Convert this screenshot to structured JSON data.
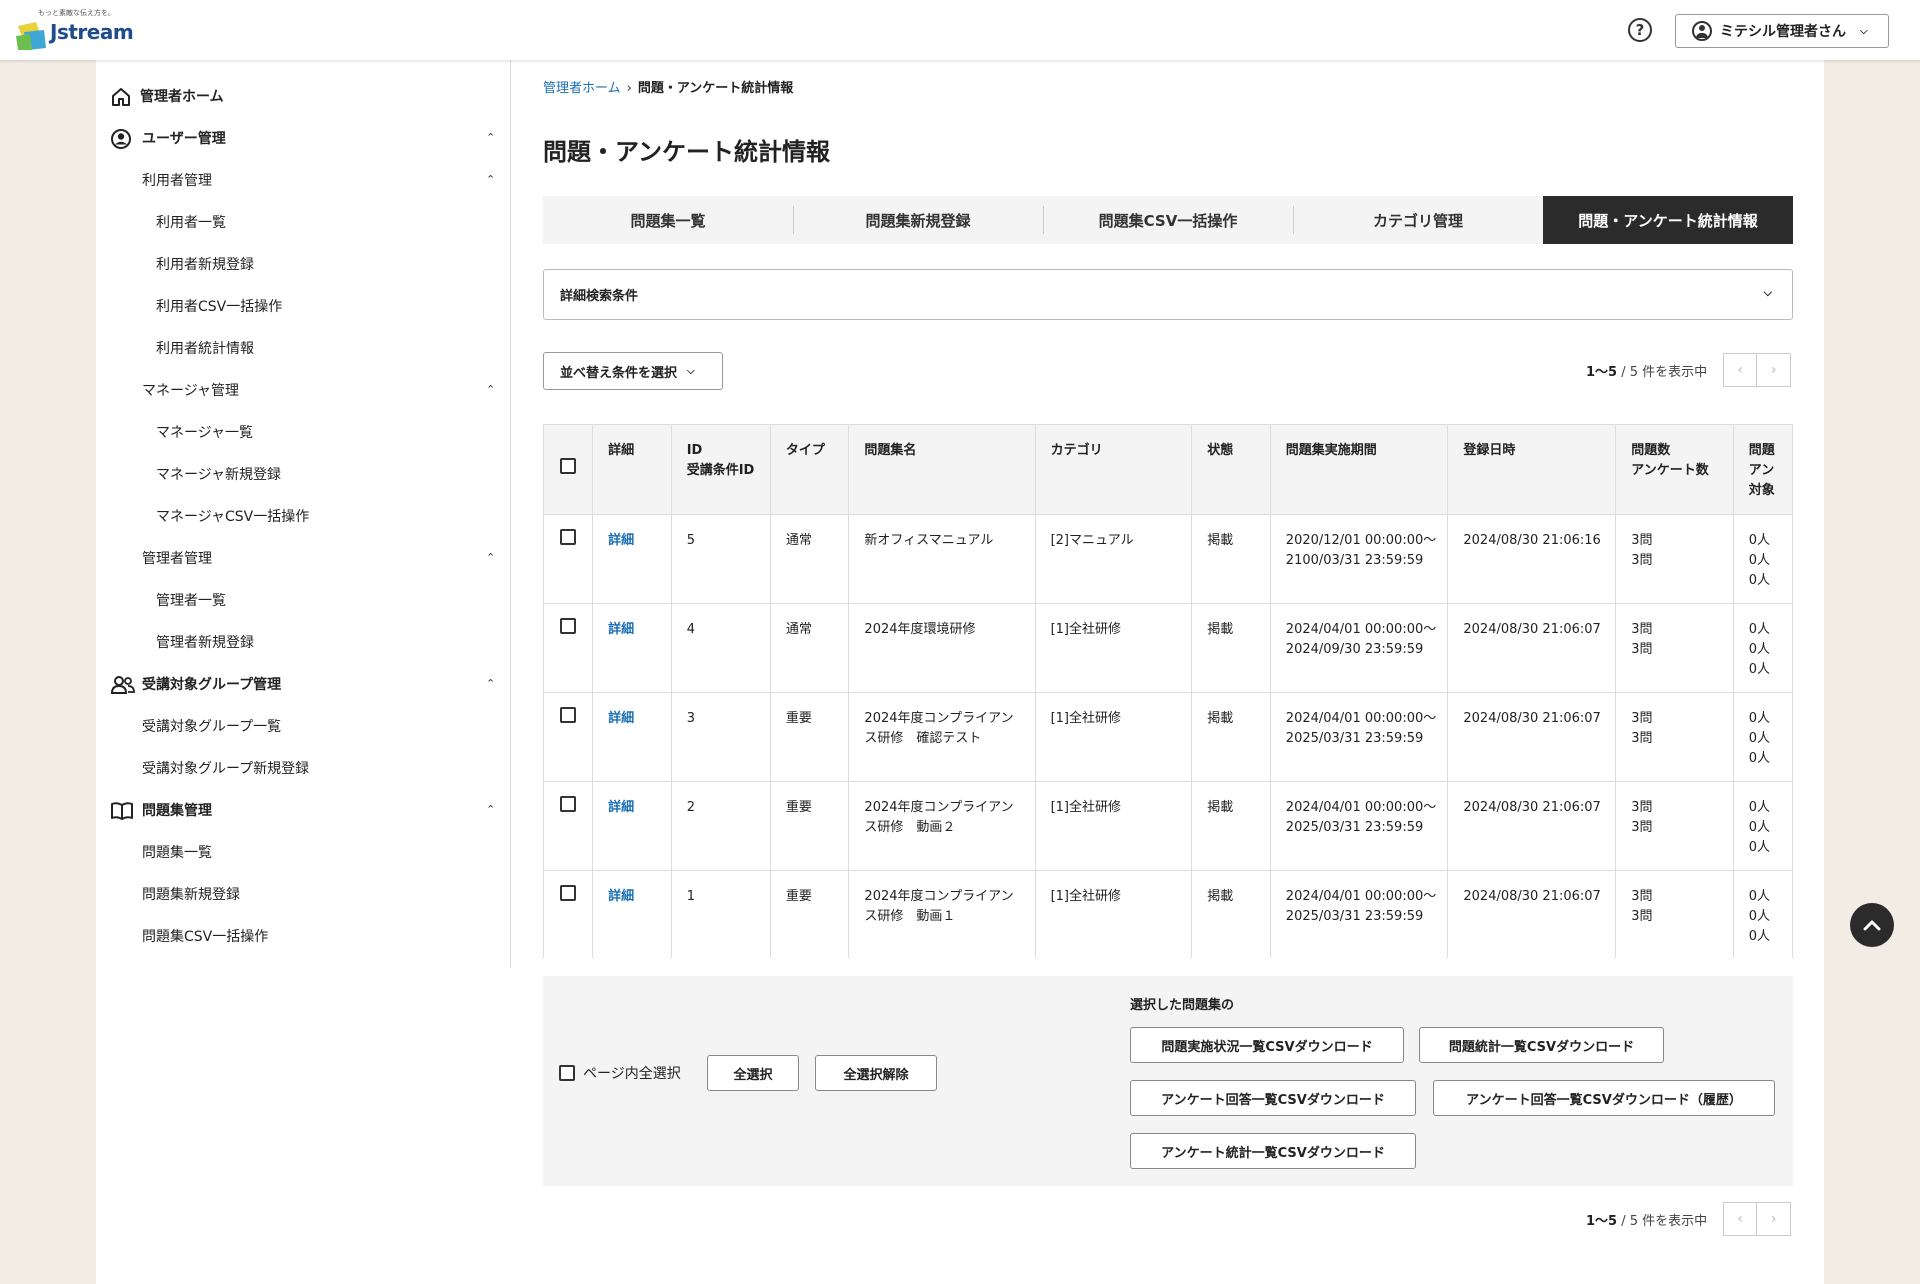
{
  "header": {
    "logo_tagline": "もっと素敵な伝え方を。",
    "logo_word": "Jstream",
    "help_symbol": "?",
    "user_label": "ミテシル管理者さん"
  },
  "sidebar": {
    "home": "管理者ホーム",
    "user_mgmt": "ユーザー管理",
    "user_admin": "利用者管理",
    "user_list": "利用者一覧",
    "user_new": "利用者新規登録",
    "user_csv": "利用者CSV一括操作",
    "user_stats": "利用者統計情報",
    "manager_mgmt": "マネージャ管理",
    "manager_list": "マネージャ一覧",
    "manager_new": "マネージャ新規登録",
    "manager_csv": "マネージャCSV一括操作",
    "admin_mgmt": "管理者管理",
    "admin_list": "管理者一覧",
    "admin_new": "管理者新規登録",
    "group_mgmt": "受講対象グループ管理",
    "group_list": "受講対象グループ一覧",
    "group_new": "受講対象グループ新規登録",
    "quiz_mgmt": "問題集管理",
    "quiz_list": "問題集一覧",
    "quiz_new": "問題集新規登録",
    "quiz_csv": "問題集CSV一括操作"
  },
  "breadcrumb": {
    "home": "管理者ホーム",
    "current": "問題・アンケート統計情報"
  },
  "page_title": "問題・アンケート統計情報",
  "tabs": [
    {
      "label": "問題集一覧"
    },
    {
      "label": "問題集新規登録"
    },
    {
      "label": "問題集CSV一括操作"
    },
    {
      "label": "カテゴリ管理"
    },
    {
      "label": "問題・アンケート統計情報"
    }
  ],
  "search_panel_label": "詳細検索条件",
  "sort_button_label": "並べ替え条件を選択",
  "pager": {
    "range": "1〜5",
    "total": " / 5 件を表示中"
  },
  "table": {
    "headers": {
      "detail": "詳細",
      "id": "ID\n受講条件ID",
      "type": "タイプ",
      "name": "問題集名",
      "category": "カテゴリ",
      "status": "状態",
      "period": "問題集実施期間",
      "registered": "登録日時",
      "counts": "問題数\nアンケート数",
      "targets": "問題\nアン\n対象"
    },
    "rows": [
      {
        "detail": "詳細",
        "id": "5",
        "type": "通常",
        "name": "新オフィスマニュアル",
        "category": "[2]マニュアル",
        "status": "掲載",
        "period": "2020/12/01 00:00:00〜\n2100/03/31 23:59:59",
        "registered": "2024/08/30 21:06:16",
        "counts": "3問\n3問",
        "targets": "0人\n0人\n0人"
      },
      {
        "detail": "詳細",
        "id": "4",
        "type": "通常",
        "name": "2024年度環境研修",
        "category": "[1]全社研修",
        "status": "掲載",
        "period": "2024/04/01 00:00:00〜\n2024/09/30 23:59:59",
        "registered": "2024/08/30 21:06:07",
        "counts": "3問\n3問",
        "targets": "0人\n0人\n0人"
      },
      {
        "detail": "詳細",
        "id": "3",
        "type": "重要",
        "name": "2024年度コンプライアン\nス研修　確認テスト",
        "category": "[1]全社研修",
        "status": "掲載",
        "period": "2024/04/01 00:00:00〜\n2025/03/31 23:59:59",
        "registered": "2024/08/30 21:06:07",
        "counts": "3問\n3問",
        "targets": "0人\n0人\n0人"
      },
      {
        "detail": "詳細",
        "id": "2",
        "type": "重要",
        "name": "2024年度コンプライアン\nス研修　動画２",
        "category": "[1]全社研修",
        "status": "掲載",
        "period": "2024/04/01 00:00:00〜\n2025/03/31 23:59:59",
        "registered": "2024/08/30 21:06:07",
        "counts": "3問\n3問",
        "targets": "0人\n0人\n0人"
      },
      {
        "detail": "詳細",
        "id": "1",
        "type": "重要",
        "name": "2024年度コンプライアン\nス研修　動画１",
        "category": "[1]全社研修",
        "status": "掲載",
        "period": "2024/04/01 00:00:00〜\n2025/03/31 23:59:59",
        "registered": "2024/08/30 21:06:07",
        "counts": "3問\n3問",
        "targets": "0人\n0人\n0人"
      }
    ]
  },
  "actions": {
    "page_select_label": "ページ内全選択",
    "select_all": "全選択",
    "deselect_all": "全選択解除",
    "selected_label": "選択した問題集の",
    "csv_progress": "問題実施状況一覧CSVダウンロード",
    "csv_stats": "問題統計一覧CSVダウンロード",
    "csv_answers": "アンケート回答一覧CSVダウンロード",
    "csv_answers_history": "アンケート回答一覧CSVダウンロード（履歴）",
    "csv_survey_stats": "アンケート統計一覧CSVダウンロード"
  },
  "icons": {
    "home": "home-icon",
    "user": "user-circle-icon",
    "group": "group-icon",
    "book": "book-icon",
    "chevron_up": "chevron-up-icon",
    "chevron_down": "chevron-down-icon",
    "scroll_top": "chevron-up-icon"
  },
  "colors": {
    "link": "#1a6fb5",
    "active_tab": "#2b2b2b",
    "background": "#f2ede4"
  }
}
